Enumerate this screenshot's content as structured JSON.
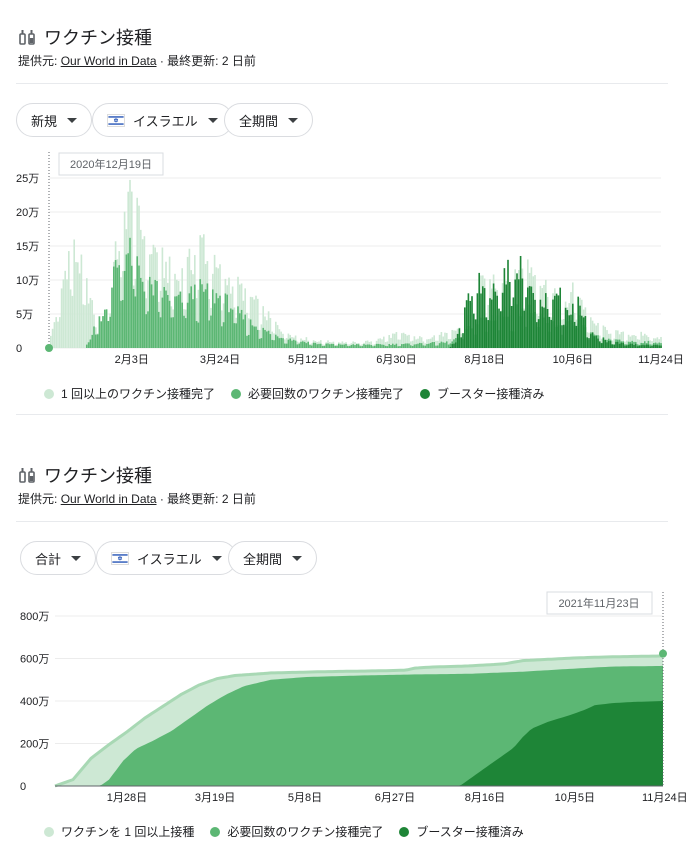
{
  "colors": {
    "light": "#cde8d4",
    "mid": "#5cb774",
    "dark": "#1e8537",
    "grid": "#ececec",
    "axis": "#202124"
  },
  "card1": {
    "title": "ワクチン接種",
    "source_prefix": "提供元:",
    "source_link": "Our World in Data",
    "source_suffix": "· 最終更新: 2 日前",
    "chips": {
      "metric": "新規",
      "country": "イスラエル",
      "period": "全期間"
    },
    "tooltip_date": "2020年12月19日",
    "legend": [
      "1 回以上のワクチン接種完了",
      "必要回数のワクチン接種完了",
      "ブースター接種済み"
    ]
  },
  "card2": {
    "title": "ワクチン接種",
    "source_prefix": "提供元:",
    "source_link": "Our World in Data",
    "source_suffix": "· 最終更新: 2 日前",
    "chips": {
      "metric": "合計",
      "country": "イスラエル",
      "period": "全期間"
    },
    "tooltip_date": "2021年11月23日",
    "legend": [
      "ワクチンを 1 回以上接種",
      "必要回数のワクチン接種完了",
      "ブースター接種済み"
    ]
  },
  "chart_data": [
    {
      "type": "bar",
      "y_unit": "万",
      "ylim": [
        0,
        25
      ],
      "y_ticks": [
        "0",
        "5万",
        "10万",
        "15万",
        "20万",
        "25万"
      ],
      "x_ticks": [
        "2月3日",
        "3月24日",
        "5月12日",
        "6月30日",
        "8月18日",
        "10月6日",
        "11月24日"
      ],
      "x_tick_days": [
        46,
        95,
        144,
        193,
        242,
        291,
        340
      ],
      "x": {
        "first_day_label": "2020年12月19日",
        "days": 341
      },
      "series_points": {
        "light": [
          [
            0,
            0.5
          ],
          [
            4,
            5
          ],
          [
            8,
            10
          ],
          [
            12,
            15
          ],
          [
            16,
            13
          ],
          [
            20,
            10
          ],
          [
            24,
            6
          ],
          [
            28,
            4
          ],
          [
            32,
            6
          ],
          [
            36,
            12
          ],
          [
            40,
            17
          ],
          [
            42,
            19
          ],
          [
            44,
            23
          ],
          [
            46,
            21
          ],
          [
            48,
            19
          ],
          [
            52,
            17
          ],
          [
            56,
            15
          ],
          [
            60,
            14
          ],
          [
            64,
            12
          ],
          [
            68,
            11
          ],
          [
            72,
            10
          ],
          [
            80,
            13
          ],
          [
            84,
            15
          ],
          [
            86,
            16
          ],
          [
            88,
            13
          ],
          [
            94,
            11
          ],
          [
            100,
            10
          ],
          [
            110,
            8
          ],
          [
            120,
            5
          ],
          [
            130,
            2.5
          ],
          [
            140,
            1.5
          ],
          [
            150,
            1
          ],
          [
            170,
            0.8
          ],
          [
            180,
            1
          ],
          [
            186,
            1.5
          ],
          [
            192,
            2
          ],
          [
            198,
            2
          ],
          [
            204,
            1.5
          ],
          [
            210,
            1.5
          ],
          [
            216,
            2
          ],
          [
            222,
            2
          ],
          [
            228,
            3
          ],
          [
            234,
            6
          ],
          [
            240,
            9
          ],
          [
            246,
            10
          ],
          [
            252,
            9.5
          ],
          [
            258,
            11
          ],
          [
            262,
            12
          ],
          [
            266,
            12.5
          ],
          [
            270,
            11
          ],
          [
            276,
            9
          ],
          [
            282,
            7
          ],
          [
            288,
            6.5
          ],
          [
            292,
            9
          ],
          [
            296,
            7
          ],
          [
            300,
            4
          ],
          [
            310,
            2.5
          ],
          [
            320,
            2
          ],
          [
            330,
            2
          ],
          [
            340,
            1.5
          ]
        ],
        "mid": [
          [
            0,
            0
          ],
          [
            20,
            0
          ],
          [
            24,
            2
          ],
          [
            28,
            5
          ],
          [
            32,
            8
          ],
          [
            36,
            11
          ],
          [
            40,
            13
          ],
          [
            44,
            14
          ],
          [
            48,
            13
          ],
          [
            52,
            10
          ],
          [
            56,
            9
          ],
          [
            60,
            8.5
          ],
          [
            64,
            8
          ],
          [
            68,
            7.5
          ],
          [
            72,
            7
          ],
          [
            80,
            8
          ],
          [
            84,
            8.5
          ],
          [
            88,
            8
          ],
          [
            94,
            7.5
          ],
          [
            100,
            6.5
          ],
          [
            110,
            4
          ],
          [
            120,
            2.5
          ],
          [
            130,
            1.5
          ],
          [
            140,
            1
          ],
          [
            150,
            0.6
          ],
          [
            170,
            0.5
          ],
          [
            180,
            0.5
          ],
          [
            200,
            0.6
          ],
          [
            220,
            0.8
          ],
          [
            228,
            1.5
          ],
          [
            234,
            3
          ],
          [
            240,
            4
          ],
          [
            246,
            4.5
          ],
          [
            252,
            5
          ],
          [
            258,
            5.5
          ],
          [
            264,
            6
          ],
          [
            270,
            5
          ],
          [
            276,
            4
          ],
          [
            282,
            3.5
          ],
          [
            288,
            3.5
          ],
          [
            292,
            5
          ],
          [
            296,
            4
          ],
          [
            300,
            2
          ],
          [
            310,
            1.2
          ],
          [
            320,
            1
          ],
          [
            340,
            0.8
          ]
        ],
        "dark": [
          [
            0,
            0
          ],
          [
            222,
            0
          ],
          [
            226,
            1
          ],
          [
            230,
            4
          ],
          [
            234,
            8
          ],
          [
            238,
            9.5
          ],
          [
            242,
            9
          ],
          [
            246,
            8.5
          ],
          [
            250,
            9.5
          ],
          [
            254,
            10.5
          ],
          [
            258,
            12
          ],
          [
            262,
            12.5
          ],
          [
            266,
            11
          ],
          [
            270,
            8
          ],
          [
            274,
            6
          ],
          [
            278,
            7.5
          ],
          [
            282,
            9
          ],
          [
            286,
            6
          ],
          [
            290,
            5.5
          ],
          [
            294,
            7
          ],
          [
            298,
            4
          ],
          [
            302,
            2
          ],
          [
            310,
            1
          ],
          [
            320,
            0.6
          ],
          [
            340,
            0.4
          ]
        ]
      },
      "legend": [
        "1 回以上のワクチン接種完了",
        "必要回数のワクチン接種完了",
        "ブースター接種済み"
      ]
    },
    {
      "type": "area",
      "y_unit": "万",
      "ylim": [
        0,
        800
      ],
      "y_ticks": [
        "0",
        "200万",
        "400万",
        "600万",
        "800万"
      ],
      "x_ticks": [
        "1月28日",
        "3月19日",
        "5月8日",
        "6月27日",
        "8月16日",
        "10月5日",
        "11月24日"
      ],
      "x_tick_days": [
        40,
        89,
        139,
        189,
        239,
        289,
        339
      ],
      "x": {
        "last_day_label": "2021年11月23日",
        "days": 340
      },
      "series_points": {
        "light": [
          [
            0,
            0
          ],
          [
            10,
            30
          ],
          [
            20,
            130
          ],
          [
            30,
            195
          ],
          [
            40,
            255
          ],
          [
            50,
            320
          ],
          [
            60,
            375
          ],
          [
            70,
            430
          ],
          [
            80,
            475
          ],
          [
            90,
            505
          ],
          [
            100,
            520
          ],
          [
            120,
            532
          ],
          [
            150,
            538
          ],
          [
            180,
            542
          ],
          [
            195,
            545
          ],
          [
            200,
            555
          ],
          [
            210,
            560
          ],
          [
            230,
            565
          ],
          [
            250,
            575
          ],
          [
            260,
            590
          ],
          [
            290,
            603
          ],
          [
            310,
            608
          ],
          [
            338,
            612
          ]
        ],
        "mid": [
          [
            0,
            0
          ],
          [
            25,
            0
          ],
          [
            30,
            30
          ],
          [
            38,
            120
          ],
          [
            45,
            175
          ],
          [
            55,
            215
          ],
          [
            65,
            260
          ],
          [
            75,
            320
          ],
          [
            85,
            380
          ],
          [
            95,
            430
          ],
          [
            105,
            470
          ],
          [
            120,
            500
          ],
          [
            140,
            513
          ],
          [
            170,
            520
          ],
          [
            200,
            525
          ],
          [
            230,
            528
          ],
          [
            260,
            538
          ],
          [
            290,
            553
          ],
          [
            310,
            562
          ],
          [
            338,
            565
          ]
        ],
        "dark": [
          [
            0,
            0
          ],
          [
            225,
            0
          ],
          [
            235,
            60
          ],
          [
            245,
            120
          ],
          [
            255,
            180
          ],
          [
            260,
            230
          ],
          [
            265,
            270
          ],
          [
            275,
            305
          ],
          [
            285,
            330
          ],
          [
            295,
            360
          ],
          [
            300,
            380
          ],
          [
            310,
            390
          ],
          [
            320,
            395
          ],
          [
            338,
            400
          ]
        ]
      },
      "end_value": 623,
      "legend": [
        "ワクチンを 1 回以上接種",
        "必要回数のワクチン接種完了",
        "ブースター接種済み"
      ]
    }
  ]
}
